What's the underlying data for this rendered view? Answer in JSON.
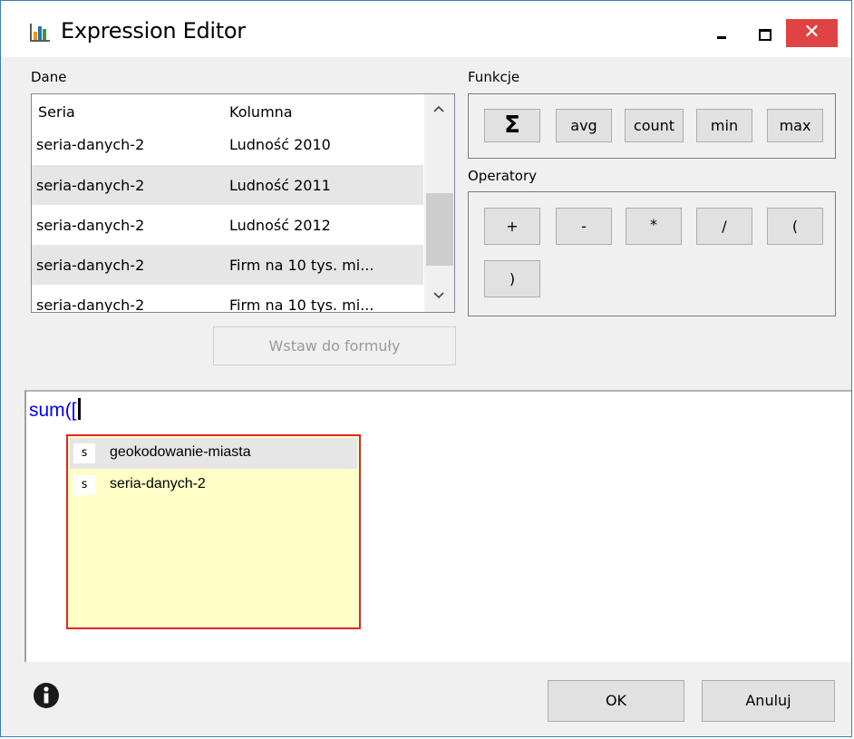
{
  "window": {
    "title": "Expression Editor"
  },
  "data_panel": {
    "label": "Dane",
    "columns": [
      "Seria",
      "Kolumna"
    ],
    "rows": [
      {
        "seria": "seria-danych-2",
        "kolumna": "Ludność 2010"
      },
      {
        "seria": "seria-danych-2",
        "kolumna": "Ludność 2011"
      },
      {
        "seria": "seria-danych-2",
        "kolumna": "Ludność 2012"
      },
      {
        "seria": "seria-danych-2",
        "kolumna": "Firm na 10 tys. mi..."
      },
      {
        "seria": "seria-danych-2",
        "kolumna": "Firm na 10 tys. mi..."
      }
    ],
    "insert_button": "Wstaw do formuły"
  },
  "functions": {
    "label": "Funkcje",
    "sum_symbol": "Σ",
    "avg": "avg",
    "count": "count",
    "min": "min",
    "max": "max"
  },
  "operators": {
    "label": "Operatory",
    "plus": "+",
    "minus": "-",
    "multiply": "*",
    "divide": "/",
    "open_paren": "(",
    "close_paren": ")"
  },
  "editor": {
    "keyword": "sum",
    "text_after": "(["
  },
  "autocomplete": {
    "items": [
      {
        "icon": "s",
        "label": "geokodowanie-miasta"
      },
      {
        "icon": "s",
        "label": "seria-danych-2"
      }
    ]
  },
  "footer": {
    "ok": "OK",
    "cancel": "Anuluj"
  },
  "colors": {
    "close_button": "#e04343",
    "autocomplete_bg": "#ffffc8",
    "autocomplete_border": "#e32626",
    "keyword": "#0000ff"
  }
}
